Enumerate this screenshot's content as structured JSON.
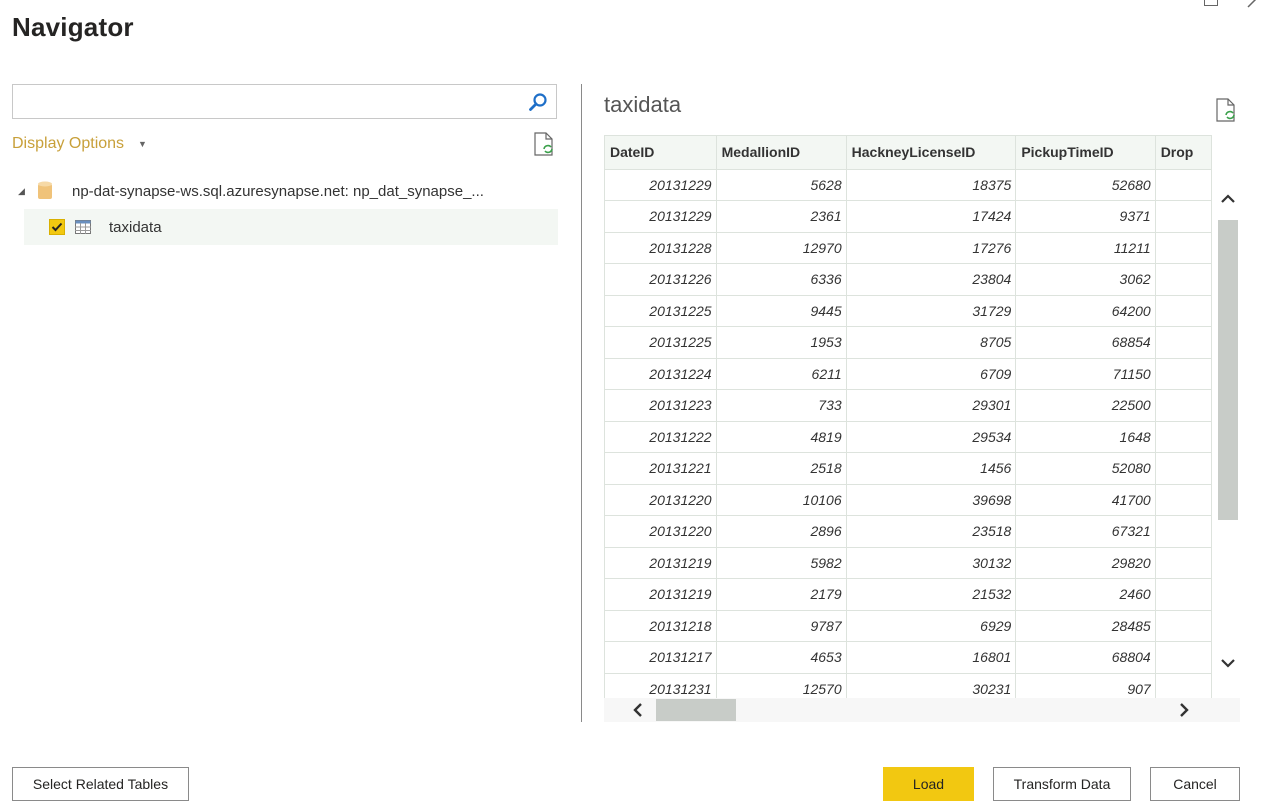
{
  "dialog": {
    "title": "Navigator"
  },
  "left_pane": {
    "search": {
      "value": "",
      "placeholder": ""
    },
    "display_options_label": "Display Options",
    "tree": {
      "root": {
        "label": "np-dat-synapse-ws.sql.azuresynapse.net: np_dat_synapse_...",
        "expanded": true,
        "icon": "database-icon"
      },
      "children": [
        {
          "label": "taxidata",
          "checked": true,
          "icon": "table-icon",
          "selected": true
        }
      ]
    }
  },
  "preview": {
    "title": "taxidata",
    "columns": [
      "DateID",
      "MedallionID",
      "HackneyLicenseID",
      "PickupTimeID",
      "Drop"
    ],
    "rows": [
      [
        "20131229",
        "5628",
        "18375",
        "52680"
      ],
      [
        "20131229",
        "2361",
        "17424",
        "9371"
      ],
      [
        "20131228",
        "12970",
        "17276",
        "11211"
      ],
      [
        "20131226",
        "6336",
        "23804",
        "3062"
      ],
      [
        "20131225",
        "9445",
        "31729",
        "64200"
      ],
      [
        "20131225",
        "1953",
        "8705",
        "68854"
      ],
      [
        "20131224",
        "6211",
        "6709",
        "71150"
      ],
      [
        "20131223",
        "733",
        "29301",
        "22500"
      ],
      [
        "20131222",
        "4819",
        "29534",
        "1648"
      ],
      [
        "20131221",
        "2518",
        "1456",
        "52080"
      ],
      [
        "20131220",
        "10106",
        "39698",
        "41700"
      ],
      [
        "20131220",
        "2896",
        "23518",
        "67321"
      ],
      [
        "20131219",
        "5982",
        "30132",
        "29820"
      ],
      [
        "20131219",
        "2179",
        "21532",
        "2460"
      ],
      [
        "20131218",
        "9787",
        "6929",
        "28485"
      ],
      [
        "20131217",
        "4653",
        "16801",
        "68804"
      ],
      [
        "20131231",
        "12570",
        "30231",
        "907"
      ]
    ]
  },
  "buttons": {
    "select_related": "Select Related Tables",
    "load": "Load",
    "transform": "Transform Data",
    "cancel": "Cancel"
  },
  "colors": {
    "accent": "#f2c811",
    "display_options": "#c8a03a"
  }
}
